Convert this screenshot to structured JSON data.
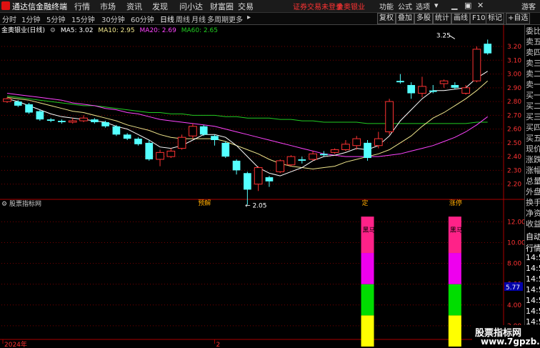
{
  "menubar": {
    "app_title": "通达信金融终端",
    "items": [
      "行情",
      "市场",
      "资讯",
      "发现",
      "问小达",
      "财富圈",
      "交易"
    ],
    "notice": "证券交易未登录",
    "brand": "金奥银业",
    "right_items": [
      "功能",
      "公式",
      "选项",
      "游客"
    ]
  },
  "toolbar": {
    "periods": [
      "分时",
      "1分钟",
      "5分钟",
      "15分钟",
      "30分钟",
      "60分钟",
      "日线",
      "周线",
      "月线",
      "多周期",
      "更多"
    ],
    "active_period": "日线",
    "tools": [
      "复权",
      "叠加",
      "多股",
      "统计",
      "画线",
      "F10",
      "标记",
      "+自选"
    ]
  },
  "chart_header": {
    "stock": "金奥银业(日线)",
    "ma5": "MA5: 3.02",
    "ma10": "MA10: 2.95",
    "ma20": "MA20: 2.69",
    "ma60": "MA60: 2.65"
  },
  "colors": {
    "up": "#ff3333",
    "down": "#54ffff",
    "ma5": "#ffffff",
    "ma10": "#f0e68c",
    "ma20": "#ff44ff",
    "ma60": "#22cc22",
    "grid": "#7a0000"
  },
  "right_panel": {
    "labels": [
      "委比",
      "卖五",
      "卖四",
      "卖三",
      "卖二",
      "卖一",
      "买一",
      "买二",
      "买三",
      "买四",
      "买五",
      "现价",
      "涨跌",
      "涨幅",
      "总量",
      "外盘",
      "换手",
      "净资",
      "收益",
      "自动",
      "行情",
      "14:50",
      "14:50",
      "14:50",
      "14:50",
      "14:50",
      "14:50",
      "14:50",
      "14:50"
    ]
  },
  "chart_data": [
    {
      "type": "candlestick",
      "title": "金奥银业(日线)",
      "y_ticks": [
        3.2,
        3.1,
        3.0,
        2.9,
        2.8,
        2.7,
        2.6,
        2.5,
        2.4,
        2.3,
        2.2
      ],
      "ylim": [
        2.11,
        3.33
      ],
      "x_labels": [
        {
          "i": 0,
          "t": "2024年"
        },
        {
          "i": 19,
          "t": "2"
        },
        {
          "i": 33,
          "t": "3"
        }
      ],
      "annotations": [
        {
          "i": 41,
          "price": 3.25,
          "text": "3.25"
        },
        {
          "i": 21,
          "price": 2.05,
          "text": "2.05"
        }
      ],
      "event_marks": [
        {
          "i": 18,
          "t": "预解"
        },
        {
          "i": 33,
          "t": "定"
        },
        {
          "i": 41,
          "t": "涨停"
        }
      ],
      "candles": [
        [
          2.8,
          2.82,
          2.83,
          2.79
        ],
        [
          2.8,
          2.77,
          2.81,
          2.76
        ],
        [
          2.78,
          2.72,
          2.79,
          2.71
        ],
        [
          2.73,
          2.67,
          2.74,
          2.66
        ],
        [
          2.67,
          2.66,
          2.68,
          2.65
        ],
        [
          2.66,
          2.65,
          2.67,
          2.64
        ],
        [
          2.65,
          2.66,
          2.68,
          2.64
        ],
        [
          2.66,
          2.68,
          2.7,
          2.65
        ],
        [
          2.67,
          2.65,
          2.68,
          2.64
        ],
        [
          2.65,
          2.62,
          2.66,
          2.61
        ],
        [
          2.62,
          2.56,
          2.63,
          2.55
        ],
        [
          2.56,
          2.53,
          2.57,
          2.52
        ],
        [
          2.53,
          2.49,
          2.54,
          2.48
        ],
        [
          2.5,
          2.38,
          2.52,
          2.37
        ],
        [
          2.38,
          2.43,
          2.45,
          2.33
        ],
        [
          2.4,
          2.44,
          2.46,
          2.39
        ],
        [
          2.46,
          2.54,
          2.56,
          2.45
        ],
        [
          2.55,
          2.62,
          2.64,
          2.53
        ],
        [
          2.62,
          2.56,
          2.63,
          2.55
        ],
        [
          2.55,
          2.52,
          2.56,
          2.48
        ],
        [
          2.5,
          2.4,
          2.51,
          2.39
        ],
        [
          2.37,
          2.3,
          2.38,
          2.27
        ],
        [
          2.28,
          2.16,
          2.29,
          2.05
        ],
        [
          2.2,
          2.32,
          2.33,
          2.15
        ],
        [
          2.25,
          2.22,
          2.26,
          2.18
        ],
        [
          2.29,
          2.37,
          2.38,
          2.28
        ],
        [
          2.34,
          2.4,
          2.41,
          2.33
        ],
        [
          2.38,
          2.37,
          2.4,
          2.35
        ],
        [
          2.38,
          2.42,
          2.44,
          2.37
        ],
        [
          2.42,
          2.41,
          2.44,
          2.4
        ],
        [
          2.43,
          2.45,
          2.46,
          2.42
        ],
        [
          2.45,
          2.49,
          2.52,
          2.44
        ],
        [
          2.48,
          2.53,
          2.55,
          2.45
        ],
        [
          2.5,
          2.39,
          2.52,
          2.37
        ],
        [
          2.48,
          2.53,
          2.58,
          2.46
        ],
        [
          2.58,
          2.8,
          2.82,
          2.56
        ],
        [
          2.95,
          2.94,
          3.0,
          2.93
        ],
        [
          2.92,
          2.86,
          2.94,
          2.82
        ],
        [
          2.86,
          2.91,
          2.98,
          2.83
        ],
        [
          2.88,
          2.87,
          2.92,
          2.86
        ],
        [
          2.93,
          2.95,
          2.96,
          2.9
        ],
        [
          2.92,
          2.9,
          2.94,
          2.89
        ],
        [
          2.86,
          2.9,
          2.92,
          2.85
        ],
        [
          2.95,
          3.18,
          3.2,
          2.94
        ],
        [
          3.22,
          3.15,
          3.25,
          3.14
        ]
      ],
      "ma5": [
        2.82,
        2.8,
        2.77,
        2.74,
        2.71,
        2.69,
        2.68,
        2.67,
        2.66,
        2.65,
        2.62,
        2.6,
        2.56,
        2.52,
        2.47,
        2.46,
        2.48,
        2.52,
        2.56,
        2.56,
        2.54,
        2.48,
        2.4,
        2.32,
        2.28,
        2.26,
        2.29,
        2.32,
        2.37,
        2.4,
        2.41,
        2.43,
        2.46,
        2.45,
        2.48,
        2.55,
        2.66,
        2.74,
        2.82,
        2.88,
        2.88,
        2.89,
        2.9,
        2.97,
        3.02
      ],
      "ma10": [
        2.83,
        2.82,
        2.81,
        2.79,
        2.77,
        2.75,
        2.73,
        2.72,
        2.7,
        2.68,
        2.66,
        2.63,
        2.61,
        2.59,
        2.56,
        2.54,
        2.53,
        2.53,
        2.53,
        2.53,
        2.51,
        2.48,
        2.45,
        2.42,
        2.38,
        2.35,
        2.33,
        2.32,
        2.31,
        2.32,
        2.33,
        2.36,
        2.38,
        2.4,
        2.42,
        2.45,
        2.5,
        2.55,
        2.62,
        2.68,
        2.72,
        2.77,
        2.82,
        2.88,
        2.95
      ],
      "ma20": [
        2.86,
        2.85,
        2.84,
        2.83,
        2.82,
        2.81,
        2.79,
        2.78,
        2.77,
        2.75,
        2.74,
        2.72,
        2.71,
        2.69,
        2.67,
        2.66,
        2.65,
        2.64,
        2.63,
        2.62,
        2.6,
        2.58,
        2.56,
        2.54,
        2.52,
        2.5,
        2.48,
        2.46,
        2.44,
        2.42,
        2.41,
        2.4,
        2.4,
        2.4,
        2.4,
        2.41,
        2.42,
        2.44,
        2.46,
        2.48,
        2.51,
        2.54,
        2.58,
        2.63,
        2.69
      ],
      "ma60": [
        2.84,
        2.83,
        2.82,
        2.81,
        2.8,
        2.79,
        2.78,
        2.77,
        2.77,
        2.76,
        2.75,
        2.74,
        2.73,
        2.72,
        2.72,
        2.71,
        2.71,
        2.7,
        2.7,
        2.7,
        2.69,
        2.69,
        2.68,
        2.68,
        2.68,
        2.67,
        2.67,
        2.66,
        2.66,
        2.65,
        2.65,
        2.65,
        2.65,
        2.64,
        2.64,
        2.64,
        2.64,
        2.64,
        2.64,
        2.64,
        2.64,
        2.64,
        2.64,
        2.65,
        2.65
      ]
    },
    {
      "type": "bar",
      "title": "股票指标网",
      "y_ticks": [
        12.0,
        10.0,
        8.0,
        6.0,
        4.0,
        2.0
      ],
      "ylim": [
        0,
        13.4
      ],
      "current_value": "5.77",
      "signal_bars": [
        {
          "i": 33,
          "label": "黑马一号",
          "segments": [
            {
              "from": 0,
              "to": 3,
              "color": "#ffff00"
            },
            {
              "from": 3,
              "to": 6,
              "color": "#00dd00"
            },
            {
              "from": 6,
              "to": 9,
              "color": "#ee00ee"
            },
            {
              "from": 9,
              "to": 12.5,
              "color": "#ff2288"
            }
          ]
        },
        {
          "i": 41,
          "label": "黑马一号",
          "segments": [
            {
              "from": 0,
              "to": 3,
              "color": "#ffff00"
            },
            {
              "from": 3,
              "to": 6,
              "color": "#00dd00"
            },
            {
              "from": 6,
              "to": 9,
              "color": "#ee00ee"
            },
            {
              "from": 9,
              "to": 12.5,
              "color": "#ff2288"
            }
          ]
        }
      ]
    }
  ],
  "watermark": {
    "line1": "股票指标网",
    "line2": "www.7gpzb.com"
  }
}
